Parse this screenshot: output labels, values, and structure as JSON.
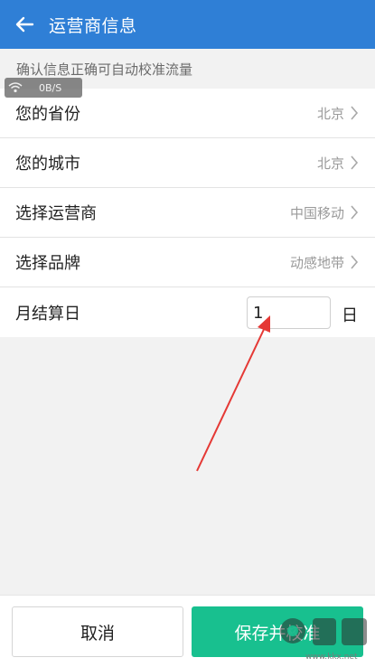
{
  "header": {
    "title": "运营商信息"
  },
  "hint": "确认信息正确可自动校准流量",
  "network_badge": {
    "speed": "0B/S"
  },
  "rows": [
    {
      "label": "您的省份",
      "value": "北京"
    },
    {
      "label": "您的城市",
      "value": "北京"
    },
    {
      "label": "选择运营商",
      "value": "中国移动"
    },
    {
      "label": "选择品牌",
      "value": "动感地带"
    }
  ],
  "billing_day": {
    "label": "月结算日",
    "value": "1",
    "unit": "日"
  },
  "buttons": {
    "cancel": "取消",
    "save": "保存并校准"
  },
  "watermark": {
    "url": "www.kkx.net"
  },
  "colors": {
    "header": "#2f7fd6",
    "save_button": "#18c08f",
    "annotation_arrow": "#e53935"
  }
}
